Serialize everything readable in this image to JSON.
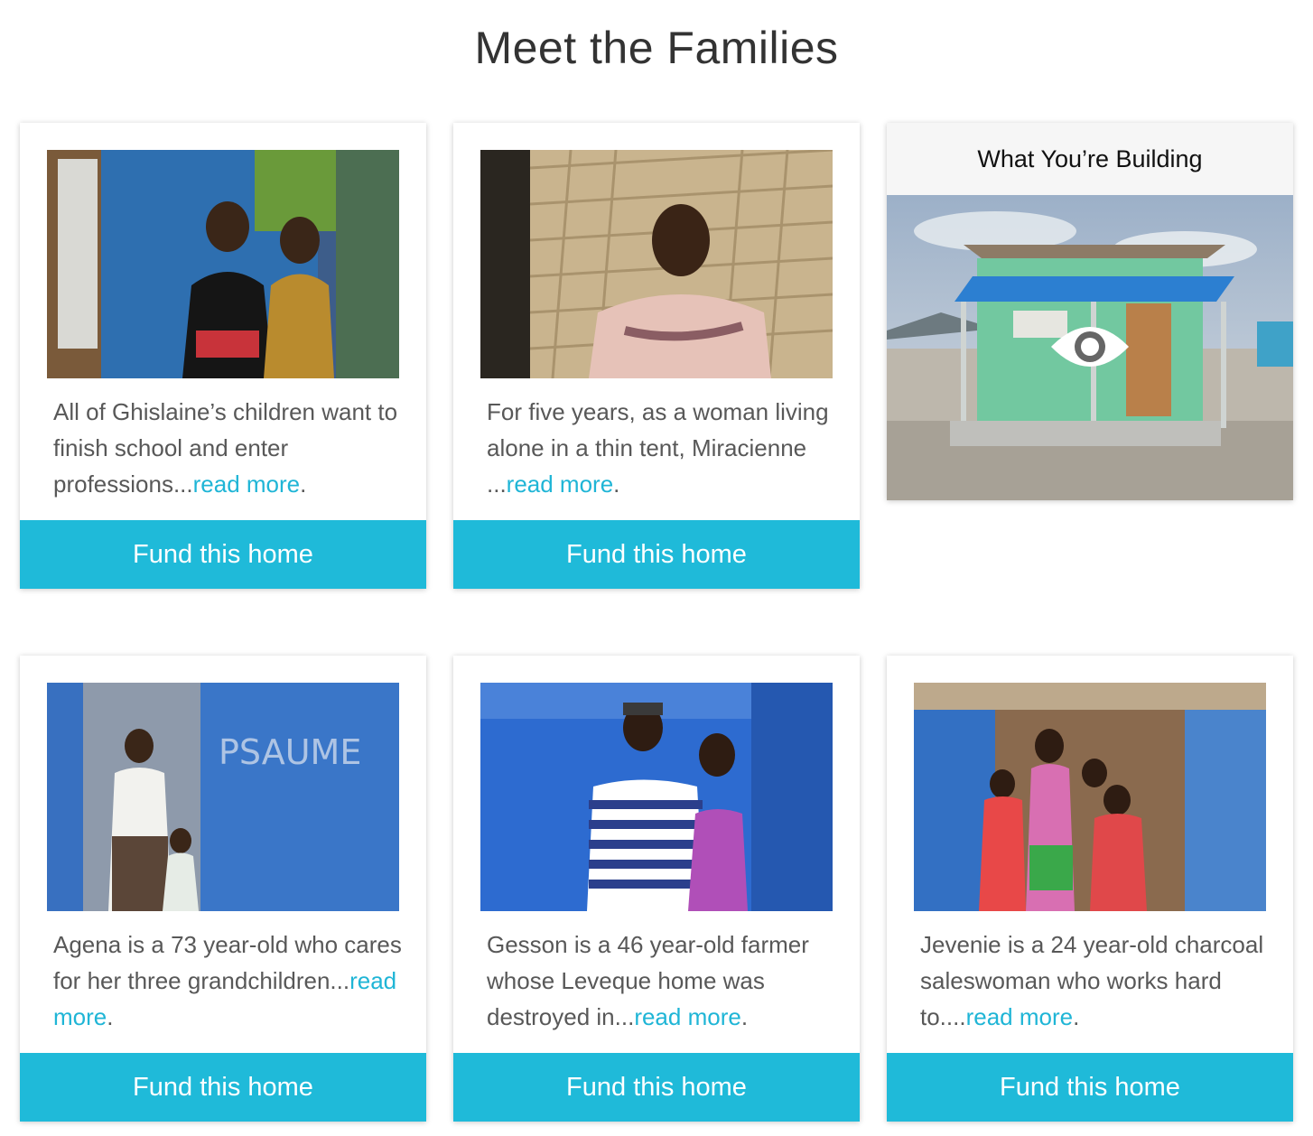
{
  "page": {
    "title": "Meet the Families"
  },
  "families": [
    {
      "blurb": "All of Ghislaine’s children want to finish school and enter professions...",
      "read_more": "read more",
      "end": ".",
      "fund_label": "Fund this home"
    },
    {
      "blurb": "For five years, as a woman living alone in a thin tent, Miracienne ...",
      "read_more": "read more",
      "end": ".",
      "fund_label": "Fund this home"
    },
    {
      "blurb": "Agena is a 73 year-old who cares for her three grandchildren...",
      "read_more": "read more",
      "end": ".",
      "fund_label": "Fund this home"
    },
    {
      "blurb": "Gesson is a 46 year-old farmer whose Leveque home was destroyed in...",
      "read_more": "read more",
      "end": ".",
      "fund_label": "Fund this home"
    },
    {
      "blurb": "Jevenie is a 24 year-old charcoal saleswoman who works hard to....",
      "read_more": "read more",
      "end": ".",
      "fund_label": "Fund this home"
    }
  ],
  "building": {
    "title": "What You’re Building",
    "icon": "eye-icon"
  },
  "colors": {
    "accent": "#1fbad9",
    "link": "#1fb5d6",
    "text": "#585858"
  }
}
